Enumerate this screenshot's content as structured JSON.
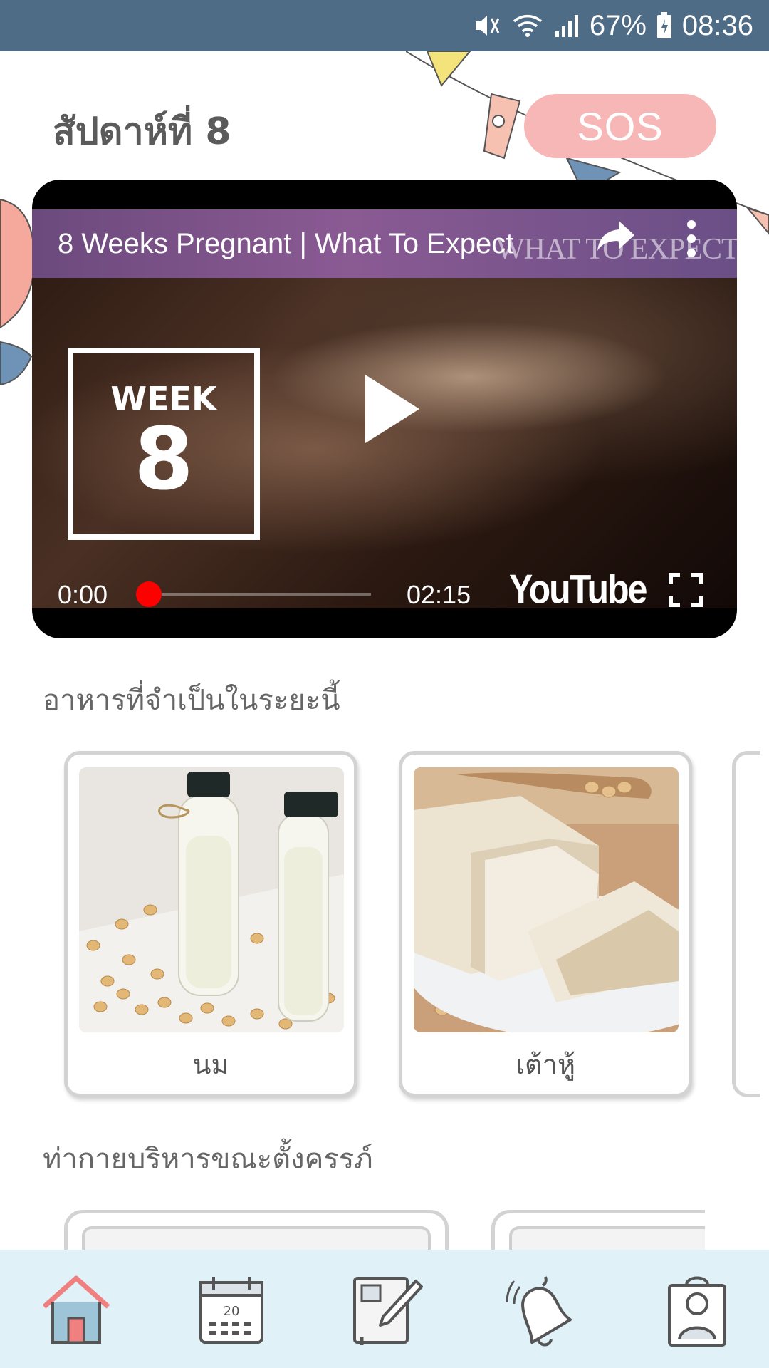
{
  "status_bar": {
    "battery": "67%",
    "time": "08:36"
  },
  "header": {
    "week_title": "สัปดาห์ที่ 8",
    "sos_label": "SOS"
  },
  "video": {
    "title": "8 Weeks Pregnant | What To Expect",
    "watermark": "WHAT TO EXPECT",
    "week_label": "WEEK",
    "week_number": "8",
    "current_time": "0:00",
    "duration": "02:15",
    "progress": 0,
    "provider": "YouTube"
  },
  "foods": {
    "title": "อาหารที่จำเป็นในระยะนี้",
    "items": [
      {
        "label": "นม",
        "image": "soy-milk-bottles"
      },
      {
        "label": "เต้าหู้",
        "image": "tofu-slices"
      }
    ]
  },
  "exercises": {
    "title": "ท่ากายบริหารขณะตั้งครรภ์"
  },
  "nav": {
    "items": [
      {
        "icon": "home-icon",
        "color": "#f08080"
      },
      {
        "icon": "calendar-icon",
        "calendar_day": "20"
      },
      {
        "icon": "notebook-icon"
      },
      {
        "icon": "bell-icon"
      },
      {
        "icon": "profile-icon"
      }
    ]
  },
  "colors": {
    "status_bar": "#4f6c87",
    "sos": "#f6b7b6",
    "nav_background": "#e0f1f7",
    "progress": "#ff0000"
  }
}
